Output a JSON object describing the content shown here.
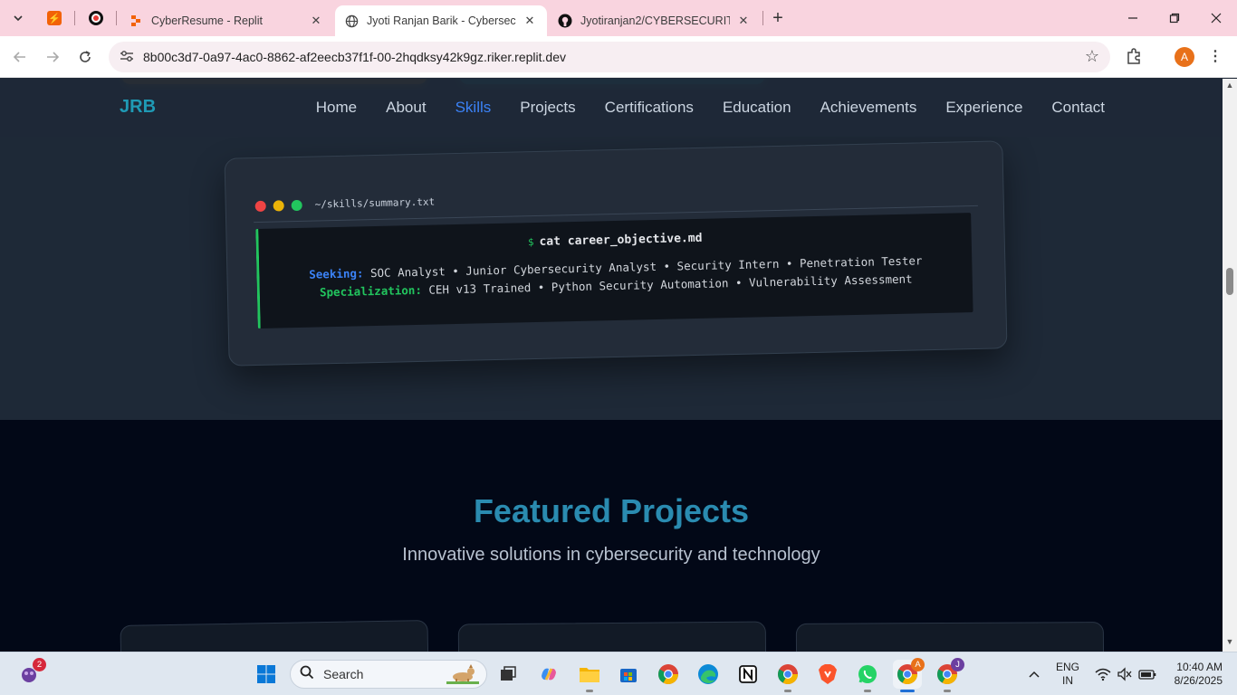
{
  "browser": {
    "tabs": [
      {
        "title": "CyberResume - Replit",
        "active": false
      },
      {
        "title": "Jyoti Ranjan Barik - Cybersecuri",
        "active": true
      },
      {
        "title": "Jyotiranjan2/CYBERSECURITY-P",
        "active": false
      }
    ],
    "url": "8b00c3d7-0a97-4ac0-8862-af2eecb37f1f-00-2hqdksy42k9gz.riker.replit.dev",
    "profile_initial": "A"
  },
  "site": {
    "brand": "JRB",
    "nav": [
      "Home",
      "About",
      "Skills",
      "Projects",
      "Certifications",
      "Education",
      "Achievements",
      "Experience",
      "Contact"
    ],
    "active_nav": "Skills"
  },
  "terminal": {
    "path": "~/skills/summary.txt",
    "prompt": "$",
    "command": "cat career_objective.md",
    "seeking_key": "Seeking:",
    "seeking_value": "SOC Analyst • Junior Cybersecurity Analyst • Security Intern • Penetration Tester",
    "spec_key": "Specialization:",
    "spec_value": "CEH v13 Trained • Python Security Automation • Vulnerability Assessment"
  },
  "projects": {
    "title": "Featured Projects",
    "subtitle": "Innovative solutions in cybersecurity and technology"
  },
  "taskbar": {
    "search_label": "Search",
    "start_badge": "2",
    "lang_line1": "ENG",
    "lang_line2": "IN",
    "time": "10:40 AM",
    "date": "8/26/2025"
  },
  "colors": {
    "brand": "#1f9ab5",
    "active_nav": "#3b82f6",
    "accent_green": "#22c55e",
    "tab_strip": "#f9d4df"
  }
}
